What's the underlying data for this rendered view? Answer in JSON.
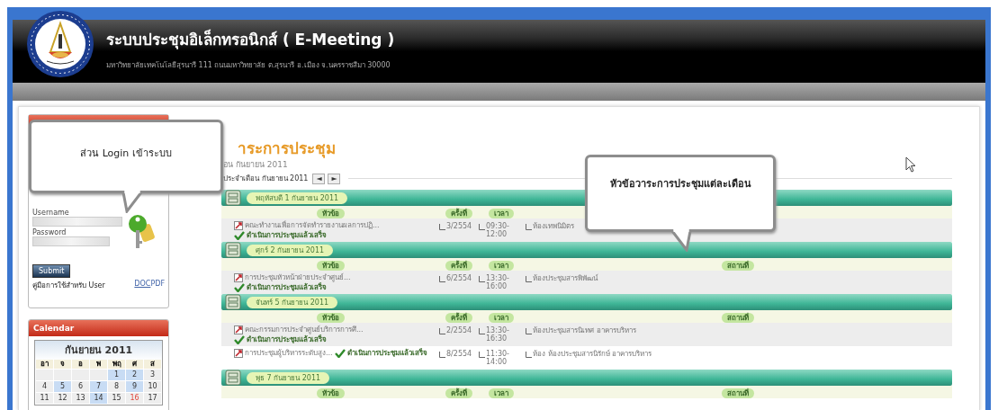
{
  "header": {
    "title": "ระบบประชุมอิเล็กทรอนิกส์ ( E-Meeting )",
    "address": "มหาวิทยาลัยเทคโนโลยีสุรนารี 111 ถนนมหาวิทยาลัย ต.สุรนารี อ.เมือง จ.นครราชสีมา 30000"
  },
  "login": {
    "username_label": "Username",
    "password_label": "Password",
    "submit": "Submit",
    "manual": "คู่มือการใช้สำหรับ User",
    "links": [
      "DOC",
      "PDF"
    ]
  },
  "calendar": {
    "title": "Calendar",
    "month": "กันยายน 2011",
    "weekdays": [
      "อา",
      "จ",
      "อ",
      "พ",
      "พฤ",
      "ศ",
      "ส"
    ],
    "weeks": [
      [
        {
          "kind": "blank"
        },
        {
          "kind": "blank"
        },
        {
          "kind": "blank"
        },
        {
          "kind": "blank"
        },
        {
          "kind": "day",
          "day": "1",
          "has_meeting": true,
          "holiday": false
        },
        {
          "kind": "day",
          "day": "2",
          "has_meeting": true,
          "holiday": false
        },
        {
          "kind": "day",
          "day": "3",
          "has_meeting": false,
          "holiday": false
        }
      ],
      [
        {
          "kind": "day",
          "day": "4",
          "has_meeting": false,
          "holiday": false
        },
        {
          "kind": "day",
          "day": "5",
          "has_meeting": true,
          "holiday": false
        },
        {
          "kind": "day",
          "day": "6",
          "has_meeting": false,
          "holiday": false
        },
        {
          "kind": "day",
          "day": "7",
          "has_meeting": true,
          "holiday": false
        },
        {
          "kind": "day",
          "day": "8",
          "has_meeting": false,
          "holiday": false
        },
        {
          "kind": "day",
          "day": "9",
          "has_meeting": true,
          "holiday": false
        },
        {
          "kind": "day",
          "day": "10",
          "has_meeting": false,
          "holiday": false
        }
      ],
      [
        {
          "kind": "day",
          "day": "11",
          "has_meeting": false,
          "holiday": false
        },
        {
          "kind": "day",
          "day": "12",
          "has_meeting": false,
          "holiday": false
        },
        {
          "kind": "day",
          "day": "13",
          "has_meeting": false,
          "holiday": false
        },
        {
          "kind": "day",
          "day": "14",
          "has_meeting": true,
          "holiday": false
        },
        {
          "kind": "day",
          "day": "15",
          "has_meeting": false,
          "holiday": false
        },
        {
          "kind": "day",
          "day": "16",
          "has_meeting": false,
          "holiday": true
        },
        {
          "kind": "day",
          "day": "17",
          "has_meeting": false,
          "holiday": false
        }
      ]
    ]
  },
  "agenda": {
    "title": "าระการประชุม",
    "subtitle": "อน  กันยายน  2011",
    "month_nav": "ประจำเดือน กันยายน 2011",
    "prev": "◄",
    "next": "►",
    "days": [
      {
        "date": "พฤหัสบดี 1 กันยายน 2011",
        "labels": [
          "หัวข้อ",
          "ครั้งที่",
          "เวลา"
        ],
        "rows": [
          {
            "topic": "คณะทำงานเพื่อการจัดทำรายงานผลการปฏิ...",
            "status": "ดำเนินการประชุมแล้วเสร็จ",
            "number": "3/2554",
            "time": "09:30-12:00",
            "place": "ห้องเทพนิมิตร",
            "selected": false
          }
        ]
      },
      {
        "date": "ศุกร์ 2 กันยายน 2011",
        "labels": [
          "หัวข้อ",
          "ครั้งที่",
          "เวลา",
          "สถานที่"
        ],
        "rows": [
          {
            "topic": "การประชุมหัวหน้าฝ่ายประจำศูนย์...",
            "status": "ดำเนินการประชุมแล้วเสร็จ",
            "number": "6/2554",
            "time": "13:30-16:00",
            "place": "ห้องประชุมสารพิพัฒน์",
            "selected": false
          }
        ]
      },
      {
        "date": "จันทร์ 5 กันยายน 2011",
        "labels": [
          "หัวข้อ",
          "ครั้งที่",
          "เวลา",
          "สถานที่"
        ],
        "rows": [
          {
            "topic": "คณะกรรมการประจำศูนย์บริการการศึ...",
            "status": "ดำเนินการประชุมแล้วเสร็จ",
            "number": "2/2554",
            "time": "13:30-16:30",
            "place": "ห้องประชุมสารนิเทศ อาคารบริหาร",
            "selected": false
          },
          {
            "topic": "การประชุมผู้บริหารระดับสูง...",
            "status": "ดำเนินการประชุมแล้วเสร็จ",
            "number": "8/2554",
            "time": "11:30-14:00",
            "place": "ห้อง ห้องประชุมสารนิรักษ์ อาคารบริหาร",
            "selected": true
          }
        ]
      },
      {
        "date": "พุธ 7 กันยายน 2011",
        "labels": [
          "หัวข้อ",
          "ครั้งที่",
          "เวลา",
          "สถานที่"
        ]
      }
    ]
  },
  "callouts": [
    {
      "kind": "login",
      "text": "ส่วน Login เข้าระบบ"
    },
    {
      "kind": "agenda",
      "text": "หัวข้อวาระการประชุมแต่ละเดือน"
    }
  ]
}
